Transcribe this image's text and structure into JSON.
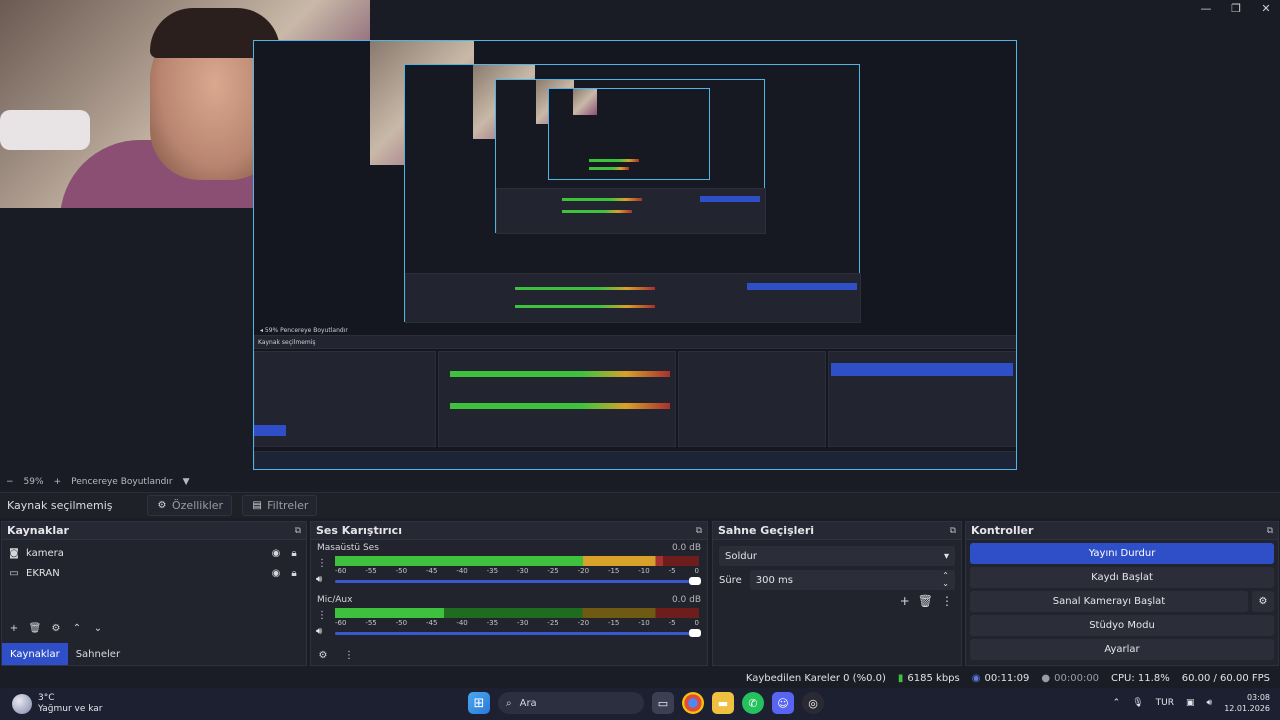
{
  "window_controls": {
    "minimize": "—",
    "maximize": "❐",
    "close": "✕"
  },
  "zoom": {
    "minus": "−",
    "level": "59%",
    "plus": "+",
    "mode": "Pencereye Boyutlandır",
    "caret": "▼"
  },
  "source_toolbar": {
    "selection_label": "Kaynak seçilmemiş",
    "properties": "Özellikler",
    "filters": "Filtreler"
  },
  "sources": {
    "title": "Kaynaklar",
    "items": [
      {
        "label": "kamera",
        "icon": "camera-icon"
      },
      {
        "label": "EKRAN",
        "icon": "monitor-icon"
      }
    ],
    "tabs": {
      "sources": "Kaynaklar",
      "scenes": "Sahneler"
    }
  },
  "mixer": {
    "title": "Ses Karıştırıcı",
    "channels": [
      {
        "name": "Masaüstü Ses",
        "db": "0.0 dB",
        "level": 0.9
      },
      {
        "name": "Mic/Aux",
        "db": "0.0 dB",
        "level": 0.3
      }
    ],
    "scale": [
      "-60",
      "-55",
      "-50",
      "-45",
      "-40",
      "-35",
      "-30",
      "-25",
      "-20",
      "-15",
      "-10",
      "-5",
      "0"
    ]
  },
  "transitions": {
    "title": "Sahne Geçişleri",
    "selected": "Soldur",
    "duration_label": "Süre",
    "duration": "300 ms"
  },
  "controls": {
    "title": "Kontroller",
    "stop_stream": "Yayını Durdur",
    "start_recording": "Kaydı Başlat",
    "start_virtual_cam": "Sanal Kamerayı Başlat",
    "studio_mode": "Stüdyo Modu",
    "settings": "Ayarlar"
  },
  "status": {
    "dropped": "Kaybedilen Kareler 0 (%0.0)",
    "bitrate": "6185 kbps",
    "stream_time": "00:11:09",
    "rec_time": "00:00:00",
    "cpu": "CPU: 11.8%",
    "fps": "60.00 / 60.00 FPS"
  },
  "taskbar": {
    "temp": "3°C",
    "weather": "Yağmur ve kar",
    "search": "Ara",
    "lang": "TUR",
    "time": "03:08",
    "date": "12.01.2026"
  },
  "colors": {
    "accent": "#2f4fc9",
    "meter_green": "#3ec23e",
    "meter_yellow": "#d8a12a",
    "meter_red": "#a83030",
    "preview_border": "#4fb4e8"
  }
}
